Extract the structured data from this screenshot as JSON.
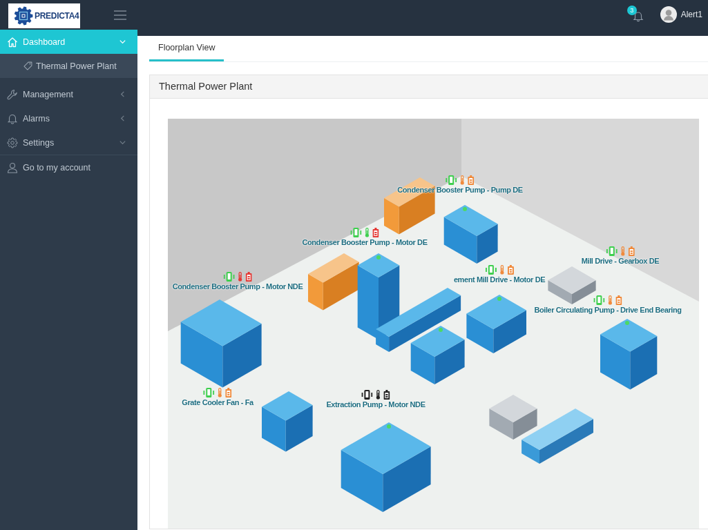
{
  "header": {
    "logo_text": "PREDICTA4",
    "notifications": "3",
    "user": "Alert1"
  },
  "sidebar": {
    "items": [
      {
        "label": "Dashboard",
        "kind": "menu",
        "selected": true,
        "expanded": true,
        "children": [
          {
            "label": "Thermal Power Plant",
            "selected": false
          }
        ]
      },
      {
        "label": "Management",
        "kind": "menu",
        "selected": false,
        "expanded": false
      },
      {
        "label": "Alarms",
        "kind": "menu",
        "selected": false,
        "expanded": false
      },
      {
        "label": "Settings",
        "kind": "menu",
        "selected": false,
        "expanded": true
      },
      {
        "label": "Go to my account",
        "kind": "link",
        "selected": false
      }
    ]
  },
  "main": {
    "tabs": [
      {
        "label": "Floorplan View",
        "selected": true
      }
    ],
    "panel": {
      "title": "Thermal Power Plant",
      "markers": [
        {
          "label": "Condenser Booster Pump - Pump DE",
          "sensors": [
            {
              "kind": "vibration",
              "color": "#3fcf4f"
            },
            {
              "kind": "temperature",
              "color": "#f08a3c"
            },
            {
              "kind": "battery",
              "color": "#f08a3c"
            }
          ]
        },
        {
          "label": "Condenser Booster Pump - Motor DE",
          "sensors": [
            {
              "kind": "vibration",
              "color": "#3fcf4f"
            },
            {
              "kind": "temperature",
              "color": "#3fcf4f"
            },
            {
              "kind": "battery",
              "color": "#e53935"
            }
          ]
        },
        {
          "label": "Condenser Booster Pump - Motor NDE",
          "sensors": [
            {
              "kind": "vibration",
              "color": "#3fcf4f"
            },
            {
              "kind": "temperature",
              "color": "#e53935"
            },
            {
              "kind": "battery",
              "color": "#e53935"
            }
          ]
        },
        {
          "label": "ement Mill Drive - Motor DE",
          "sensors": [
            {
              "kind": "vibration",
              "color": "#3fcf4f"
            },
            {
              "kind": "temperature",
              "color": "#f08a3c"
            },
            {
              "kind": "battery",
              "color": "#f08a3c"
            }
          ]
        },
        {
          "label": "Mill Drive - Gearbox DE",
          "sensors": [
            {
              "kind": "vibration",
              "color": "#3fcf4f"
            },
            {
              "kind": "temperature",
              "color": "#f08a3c"
            },
            {
              "kind": "battery",
              "color": "#f08a3c"
            }
          ]
        },
        {
          "label": "Boiler Circulating Pump - Drive End Bearing",
          "sensors": [
            {
              "kind": "vibration",
              "color": "#3fcf4f"
            },
            {
              "kind": "temperature",
              "color": "#f08a3c"
            },
            {
              "kind": "battery",
              "color": "#f08a3c"
            }
          ]
        },
        {
          "label": "Grate Cooler Fan - Fa",
          "sensors": [
            {
              "kind": "vibration",
              "color": "#3fcf4f"
            },
            {
              "kind": "temperature",
              "color": "#f08a3c"
            },
            {
              "kind": "battery",
              "color": "#f08a3c"
            }
          ]
        },
        {
          "label": "Extraction Pump - Motor NDE",
          "sensors": [
            {
              "kind": "vibration",
              "color": "#222222"
            },
            {
              "kind": "temperature",
              "color": "#222222"
            },
            {
              "kind": "battery",
              "color": "#222222"
            }
          ]
        }
      ]
    }
  }
}
